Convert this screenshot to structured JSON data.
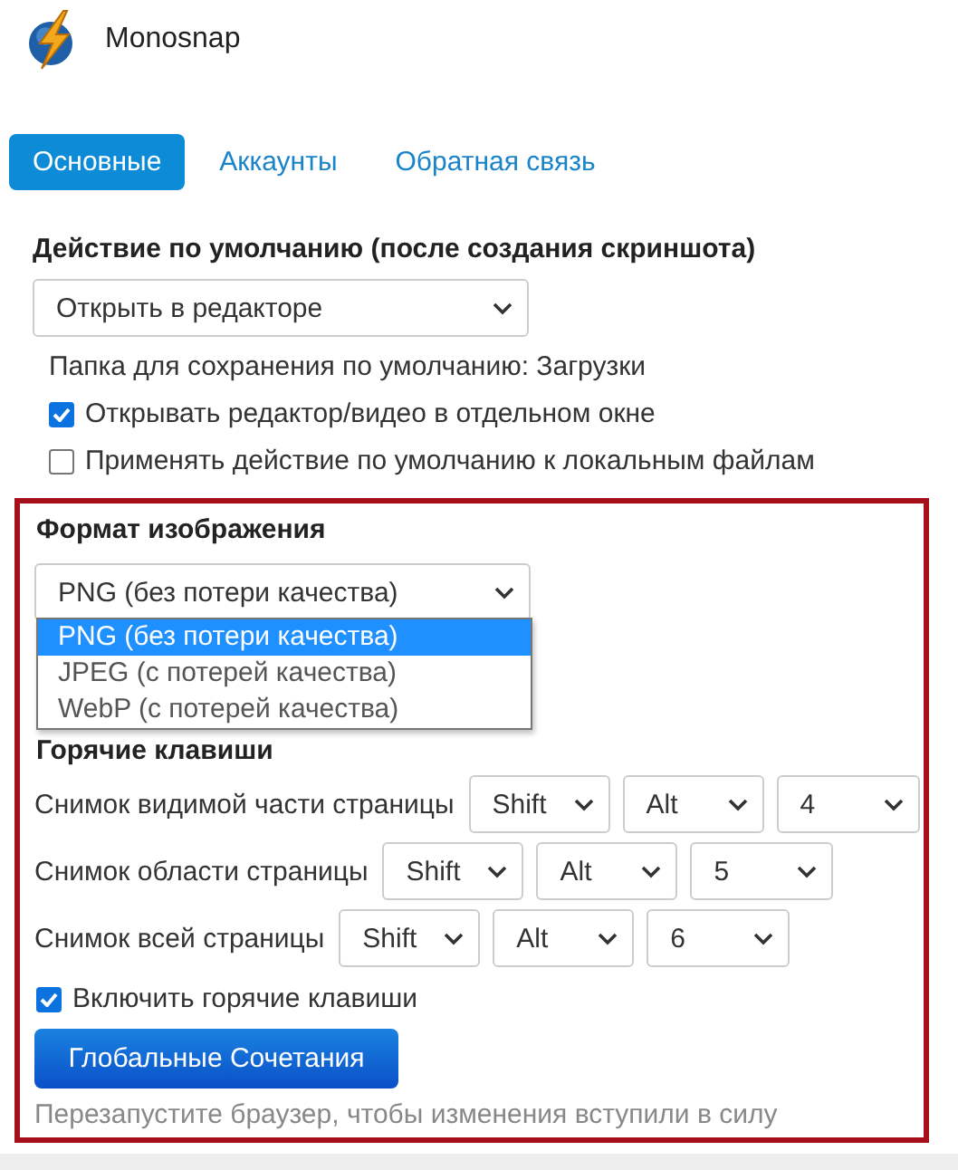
{
  "app": {
    "title": "Monosnap"
  },
  "tabs": [
    {
      "label": "Основные",
      "selected": true
    },
    {
      "label": "Аккаунты",
      "selected": false
    },
    {
      "label": "Обратная связь",
      "selected": false
    }
  ],
  "default_action": {
    "heading": "Действие по умолчанию (после создания скриншота)",
    "value": "Открыть в редакторе"
  },
  "save_folder": "Папка для сохранения по умолчанию: Загрузки",
  "options": [
    {
      "label": "Открывать редактор/видео в отдельном окне",
      "checked": true
    },
    {
      "label": "Применять действие по умолчанию к локальным файлам",
      "checked": false
    }
  ],
  "image_format": {
    "heading": "Формат изображения",
    "value": "PNG (без потери качества)",
    "expanded": true,
    "options": [
      {
        "label": "PNG (без потери качества)",
        "selected": true
      },
      {
        "label": "JPEG (с потерей качества)",
        "selected": false
      },
      {
        "label": "WebP (с потерей качества)",
        "selected": false
      }
    ]
  },
  "hotkeys": {
    "heading": "Горячие клавиши",
    "rows": [
      {
        "label": "Снимок видимой части страницы",
        "modifier_1": "Shift",
        "modifier_2": "Alt",
        "key": "4"
      },
      {
        "label": "Снимок области страницы",
        "modifier_1": "Shift",
        "modifier_2": "Alt",
        "key": "5"
      },
      {
        "label": "Снимок всей страницы",
        "modifier_1": "Shift",
        "modifier_2": "Alt",
        "key": "6"
      }
    ],
    "enable": {
      "label": "Включить горячие клавиши",
      "checked": true
    },
    "button": "Глобальные Сочетания",
    "note": "Перезапустите браузер, чтобы изменения вступили в силу"
  }
}
